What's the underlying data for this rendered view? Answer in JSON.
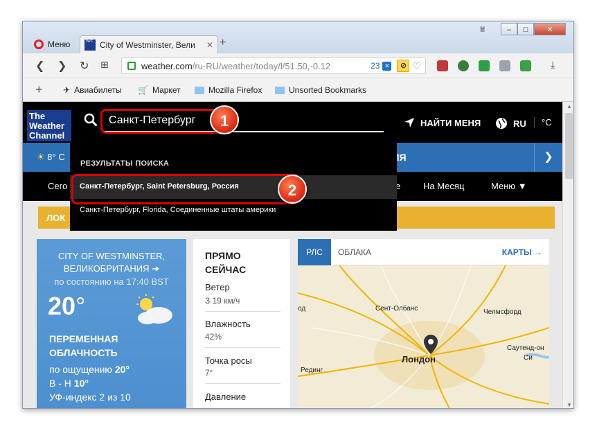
{
  "browser": {
    "tabs": [
      {
        "label": "Меню"
      },
      {
        "label": "City of Westminster, Вели",
        "favicon": "The Weather Channel"
      }
    ],
    "url_host": "weather.com",
    "url_path": "/ru-RU/weather/today/l/51.50,-0.12",
    "url_badge_count": "23",
    "bookmarks": [
      "Авиабилеты",
      "Маркет",
      "Mozilla Firefox",
      "Unsorted Bookmarks"
    ]
  },
  "site": {
    "logo_lines": [
      "The",
      "Weather",
      "Channel"
    ],
    "search_value": "Санкт-Петербург",
    "find_me": "НАЙТИ МЕНЯ",
    "lang": "RU",
    "unit": "°C",
    "blue_temp": "8° C",
    "blue_title": "ЕНИЯ",
    "nav": [
      "Сего",
      "е",
      "На Месяц",
      "Меню"
    ],
    "banner": "ЛОК"
  },
  "dropdown": {
    "heading": "РЕЗУЛЬТАТЫ ПОИСКА",
    "results": [
      "Санкт-Петербург, Saint Petersburg, Россия",
      "Санкт-Петербург, Florida, Соединенные штаты америки"
    ]
  },
  "markers": [
    "1",
    "2"
  ],
  "weather": {
    "city_line1": "CITY OF WESTMINSTER,",
    "city_line2": "ВЕЛИКОБРИТАНИЯ",
    "as_of": "по состоянию на 17:40 BST",
    "temp": "20",
    "degree": "°",
    "condition_line1": "ПЕРЕМЕННАЯ",
    "condition_line2": "ОБЛАЧНОСТЬ",
    "feels_label": "по ощущению ",
    "feels_value": "20°",
    "hi_lo": "В - Н ",
    "hi_lo_value": "10°",
    "uv": "УФ-индекс 2 из 10"
  },
  "now": {
    "heading_line1": "ПРЯМО",
    "heading_line2": "СЕЙЧАС",
    "items": [
      {
        "label": "Ветер",
        "value": "З 19 км/ч"
      },
      {
        "label": "Влажность",
        "value": "42%"
      },
      {
        "label": "Точка росы",
        "value": "7°"
      },
      {
        "label": "Давление",
        "value": ""
      }
    ]
  },
  "map": {
    "tab_active": "РЛС",
    "tab_other": "ОБЛАКА",
    "link": "КАРТЫ →",
    "labels": [
      "од",
      "Сент-Олбанс",
      "Челмсфорд",
      "Лондон",
      "Саутенд-он",
      "Си",
      "Рединг"
    ]
  },
  "colors": {
    "accent_blue": "#2d6fb4",
    "banner_yellow": "#e8b230",
    "marker_red": "#e00000"
  }
}
